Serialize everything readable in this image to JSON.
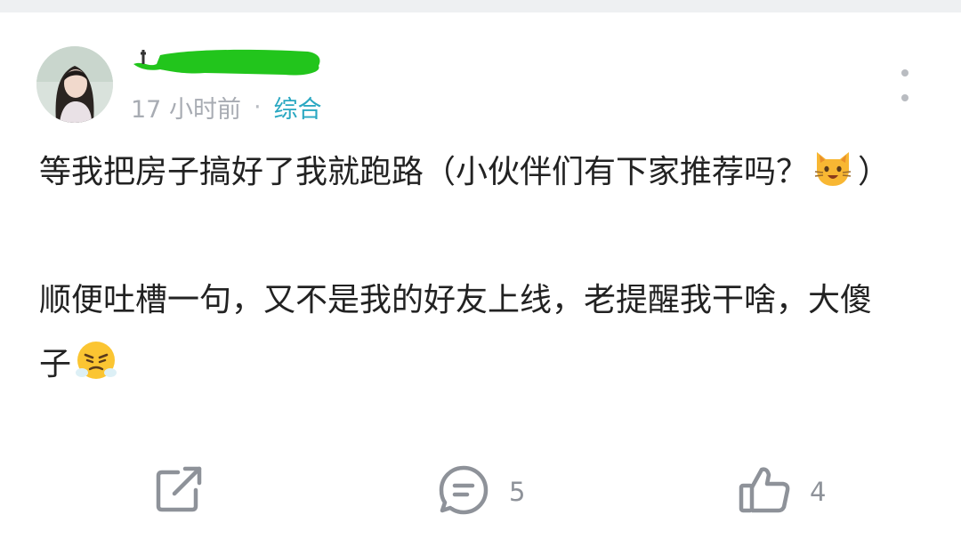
{
  "post": {
    "time_ago": "17 小时前",
    "separator": "·",
    "category": "综合",
    "paragraph1": "等我把房子搞好了我就跑路（小伙伴们有下家推荐吗？",
    "paragraph1_end": "）",
    "paragraph2": "顺便吐槽一句，又不是我的好友上线，老提醒我干啥，大傻子",
    "emoji1": "cat-face-emoji",
    "emoji2": "steam-face-emoji"
  },
  "actions": {
    "share_icon": "share-icon",
    "comment_icon": "comment-icon",
    "comment_count": "5",
    "like_icon": "thumbs-up-icon",
    "like_count": "4"
  },
  "colors": {
    "category": "#2aa8c2",
    "meta_text": "#a8acb3",
    "body_text": "#222222",
    "icon": "#8e9299",
    "redaction": "#22c51c"
  }
}
